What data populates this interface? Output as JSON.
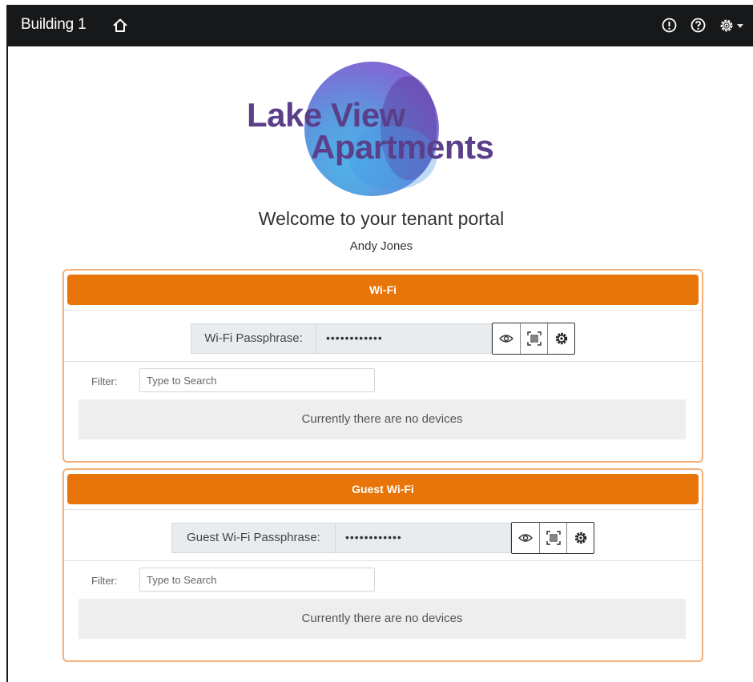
{
  "topbar": {
    "title": "Building 1",
    "icons": [
      "home-icon",
      "alert-icon",
      "help-icon",
      "gear-icon"
    ]
  },
  "logo": {
    "line1": "Lake View",
    "line2": "Apartments",
    "text_color": "#5b3f8a"
  },
  "welcome": {
    "heading": "Welcome to your tenant portal",
    "tenant_name": "Andy Jones"
  },
  "sections": {
    "wifi": {
      "title": "Wi-Fi",
      "passphrase_label": "Wi-Fi Passphrase:",
      "passphrase_value": "••••••••••••",
      "filter_label": "Filter:",
      "filter_placeholder": "Type to Search",
      "empty_message": "Currently there are no devices"
    },
    "guest_wifi": {
      "title": "Guest Wi-Fi",
      "passphrase_label": "Guest Wi-Fi Passphrase:",
      "passphrase_value": "••••••••••••",
      "filter_label": "Filter:",
      "filter_placeholder": "Type to Search",
      "empty_message": "Currently there are no devices"
    }
  },
  "passphrase_buttons": [
    "eye-icon",
    "qr-code-icon",
    "gear-icon"
  ],
  "colors": {
    "topbar": "#16181a",
    "accent": "#e8750a",
    "card_border": "#f4b27a"
  }
}
